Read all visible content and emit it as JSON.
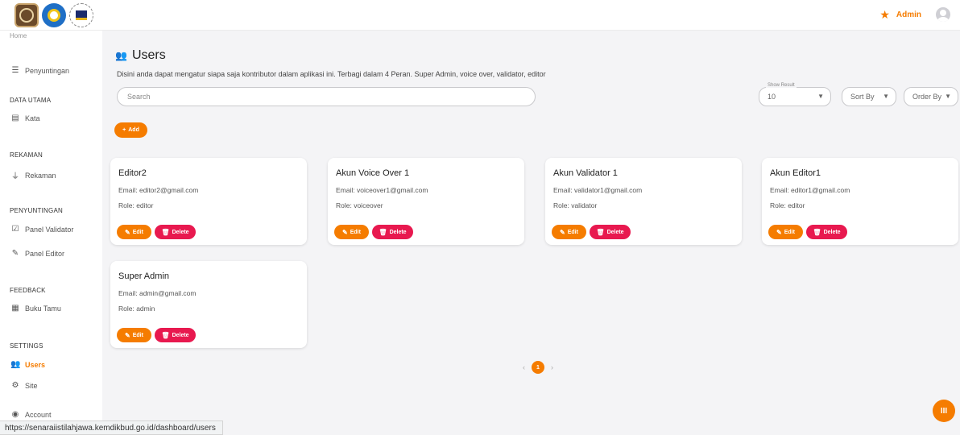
{
  "header": {
    "logos": [
      "app-logo",
      "kemdikbud-logo",
      "institution-logo"
    ],
    "admin_label": "Admin"
  },
  "sidebar": {
    "cut_off_item": "Home",
    "items_top": [
      {
        "label": "Penyuntingan",
        "icon": "list-icon"
      }
    ],
    "sections": [
      {
        "title": "DATA UTAMA",
        "items": [
          {
            "label": "Kata",
            "icon": "book-icon"
          }
        ]
      },
      {
        "title": "REKAMAN",
        "items": [
          {
            "label": "Rekaman",
            "icon": "microphone-icon"
          }
        ]
      },
      {
        "title": "PENYUNTINGAN",
        "items": [
          {
            "label": "Panel Validator",
            "icon": "check-icon"
          },
          {
            "label": "Panel Editor",
            "icon": "pencil-icon"
          }
        ]
      },
      {
        "title": "FEEDBACK",
        "items": [
          {
            "label": "Buku Tamu",
            "icon": "message-icon"
          }
        ]
      },
      {
        "title": "SETTINGS",
        "items": [
          {
            "label": "Users",
            "icon": "users-icon",
            "active": true
          },
          {
            "label": "Site",
            "icon": "gear-icon"
          },
          {
            "label": "Account",
            "icon": "account-icon"
          }
        ]
      }
    ]
  },
  "main": {
    "title": "Users",
    "description": "Disini anda dapat mengatur siapa saja kontributor dalam aplikasi ini. Terbagi dalam 4 Peran. Super Admin, voice over, validator, editor",
    "search_placeholder": "Search",
    "show_result_label": "Show Result",
    "show_result_value": "10",
    "sort_by_label": "Sort By",
    "order_by_label": "Order By",
    "add_label": "Add",
    "edit_label": "Edit",
    "delete_label": "Delete",
    "users": [
      {
        "name": "Editor2",
        "email": "Email: editor2@gmail.com",
        "role": "Role: editor"
      },
      {
        "name": "Akun Voice Over 1",
        "email": "Email: voiceover1@gmail.com",
        "role": "Role: voiceover"
      },
      {
        "name": "Akun Validator 1",
        "email": "Email: validator1@gmail.com",
        "role": "Role: validator"
      },
      {
        "name": "Akun Editor1",
        "email": "Email: editor1@gmail.com",
        "role": "Role: editor"
      },
      {
        "name": "Super Admin",
        "email": "Email: admin@gmail.com",
        "role": "Role: admin"
      }
    ],
    "pagination": {
      "current": "1",
      "prev": "‹",
      "next": "›"
    }
  },
  "fab_label": "III",
  "status_url": "https://senaraiistilahjawa.kemdikbud.go.id/dashboard/users",
  "colors": {
    "accent": "#f57c00",
    "danger": "#e8194f"
  }
}
